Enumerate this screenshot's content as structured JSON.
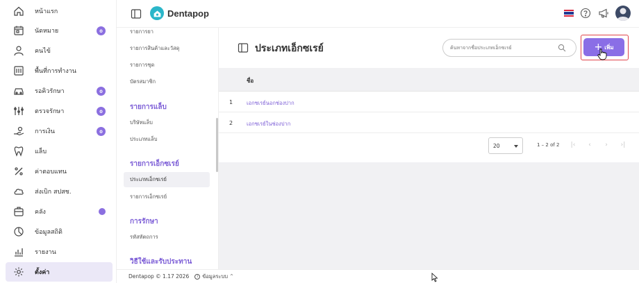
{
  "sidebar": {
    "items": [
      {
        "label": "หน้าแรก",
        "icon": "home-icon"
      },
      {
        "label": "นัดหมาย",
        "icon": "calendar-icon",
        "badge": "0"
      },
      {
        "label": "คนไข้",
        "icon": "user-icon"
      },
      {
        "label": "พื้นที่การทำงาน",
        "icon": "workspace-icon"
      },
      {
        "label": "รอคิวรักษา",
        "icon": "car-queue-icon",
        "badge": "0"
      },
      {
        "label": "ตรวจรักษา",
        "icon": "tools-icon",
        "badge": "0"
      },
      {
        "label": "การเงิน",
        "icon": "payment-hand-icon",
        "badge": "0"
      },
      {
        "label": "แล็บ",
        "icon": "tooth-icon"
      },
      {
        "label": "ค่าตอบแทน",
        "icon": "percent-icon"
      },
      {
        "label": "ส่งเบิก สปสช.",
        "icon": "cloud-icon"
      },
      {
        "label": "คลัง",
        "icon": "inventory-icon"
      },
      {
        "label": "ข้อมูลสถิติ",
        "icon": "statistics-icon"
      },
      {
        "label": "รายงาน",
        "icon": "report-chart-icon"
      },
      {
        "label": "ตั้งค่า",
        "icon": "settings-gear-icon"
      }
    ],
    "accent": "#8b6fe0"
  },
  "header": {
    "brand": "Dentapop"
  },
  "submenu": {
    "items_top": [
      "รายการยา",
      "รายการสินค้าและวัสดุ",
      "รายการชุด",
      "บัตรสมาชิก"
    ],
    "section_lab": "รายการแล็บ",
    "items_lab": [
      "บริษัทแล็บ",
      "ประเภทแล็บ"
    ],
    "section_xray": "รายการเอ็กซเรย์",
    "items_xray": [
      "ประเภทเอ็กซเรย์",
      "รายการเอ็กซเรย์"
    ],
    "section_treatment": "การรักษา",
    "items_treatment": [
      "รหัสหัตถการ"
    ],
    "section_payment": "วิธีใช้และรับประทาน"
  },
  "main": {
    "title": "ประเภทเอ็กซเรย์",
    "search_placeholder": "ค้นหาจากชื่อประเภทเอ็กซเรย์",
    "add_label": "เพิ่ม",
    "column_name": "ชื่อ",
    "rows": [
      {
        "num": "1",
        "name": "เอกซเรย์นอกช่องปาก"
      },
      {
        "num": "2",
        "name": "เอกซเรย์ในช่องปาก"
      }
    ],
    "page_size": "20",
    "range": "1 – 2 of 2"
  },
  "footer": {
    "version": "Dentapop © 1.17 2026",
    "info": "ข้อมูลระบบ"
  }
}
